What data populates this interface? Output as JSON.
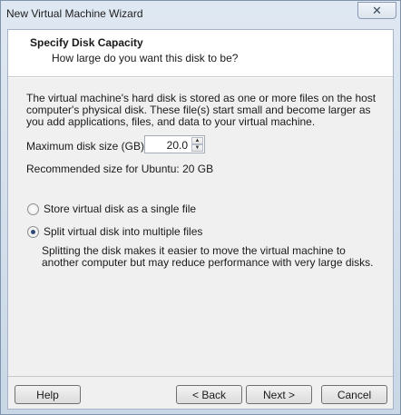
{
  "window": {
    "title": "New Virtual Machine Wizard",
    "close_symbol": "✕"
  },
  "header": {
    "title": "Specify Disk Capacity",
    "subtitle": "How large do you want this disk to be?"
  },
  "description": "The virtual machine's hard disk is stored as one or more files on the host computer's physical disk. These file(s) start small and become larger as you add applications, files, and data to your virtual machine.",
  "disk": {
    "label": "Maximum disk size (GB):",
    "value": "20.0",
    "recommended": "Recommended size for Ubuntu: 20 GB"
  },
  "options": {
    "single_label": "Store virtual disk as a single file",
    "single_checked": false,
    "split_label": "Split virtual disk into multiple files",
    "split_checked": true,
    "split_description": "Splitting the disk makes it easier to move the virtual machine to another computer but may reduce performance with very large disks."
  },
  "buttons": {
    "help": "Help",
    "back": "< Back",
    "next": "Next >",
    "cancel": "Cancel"
  },
  "icons": {
    "spin_up": "spin-up-arrow-icon",
    "spin_down": "spin-down-arrow-icon",
    "close": "close-icon"
  }
}
